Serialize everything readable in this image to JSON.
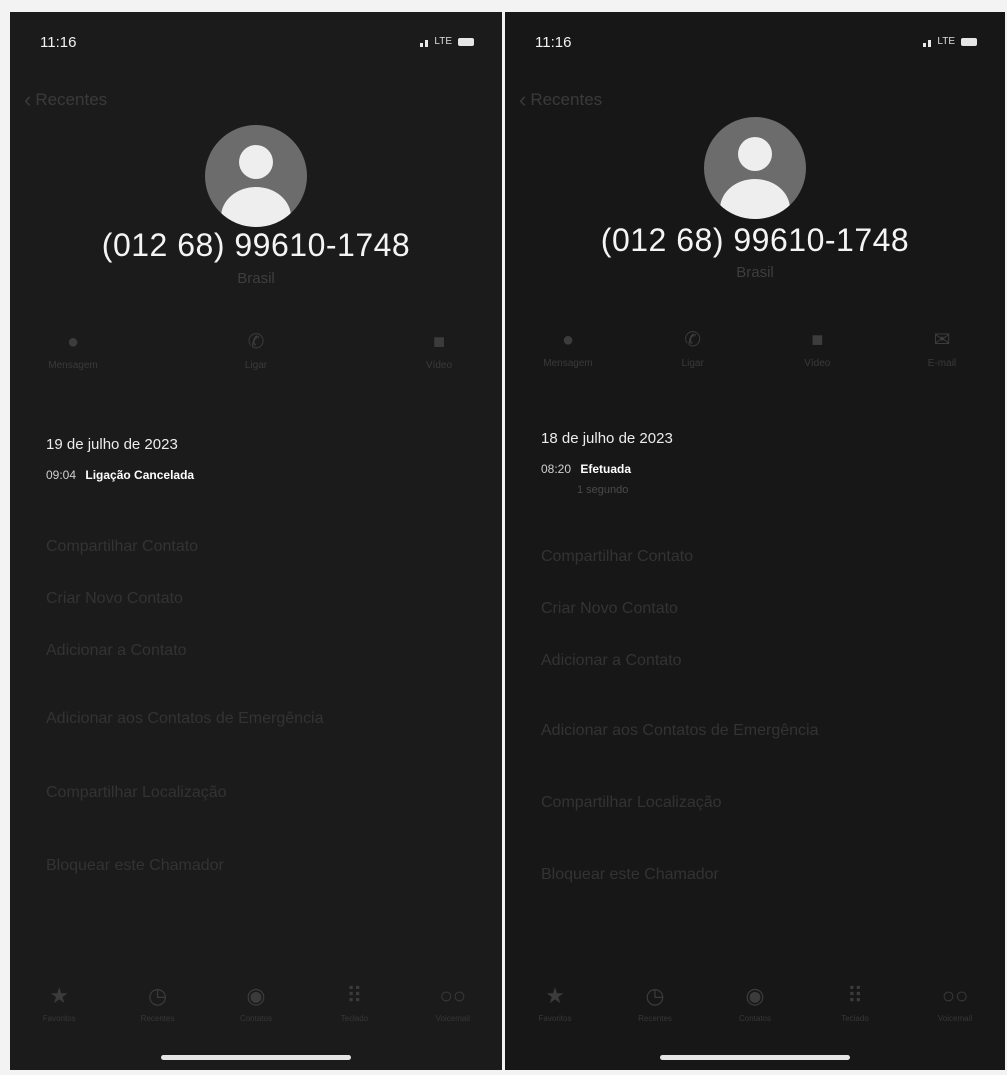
{
  "left": {
    "status": {
      "time": "11:16",
      "network": "LTE"
    },
    "back_label": "Recentes",
    "contact": {
      "number": "(012 68) 99610-1748",
      "country": "Brasil"
    },
    "actions": [
      {
        "label": "Mensagem",
        "icon": "message-icon"
      },
      {
        "label": "Ligar",
        "icon": "phone-icon"
      },
      {
        "label": "Vídeo",
        "icon": "video-icon"
      }
    ],
    "call_date": "19 de julho de 2023",
    "call_time": "09:04",
    "call_type": "Ligação Cancelada",
    "menu": [
      "Compartilhar Contato",
      "Criar Novo Contato",
      "Adicionar a Contato",
      "Adicionar aos Contatos de Emergência",
      "Compartilhar Localização",
      "Bloquear este Chamador"
    ],
    "tabs": [
      "Favoritos",
      "Recentes",
      "Contatos",
      "Teclado",
      "Voicemail"
    ]
  },
  "right": {
    "status": {
      "time": "11:16",
      "network": "LTE"
    },
    "back_label": "Recentes",
    "contact": {
      "number": "(012 68) 99610-1748",
      "country": "Brasil"
    },
    "actions": [
      {
        "label": "Mensagem",
        "icon": "message-icon"
      },
      {
        "label": "Ligar",
        "icon": "phone-icon"
      },
      {
        "label": "Vídeo",
        "icon": "video-icon"
      },
      {
        "label": "E-mail",
        "icon": "mail-icon"
      }
    ],
    "call_date": "18 de julho de 2023",
    "call_time": "08:20",
    "call_type": "Efetuada",
    "call_duration": "1 segundo",
    "menu": [
      "Compartilhar Contato",
      "Criar Novo Contato",
      "Adicionar a Contato",
      "Adicionar aos Contatos de Emergência",
      "Compartilhar Localização",
      "Bloquear este Chamador"
    ],
    "tabs": [
      "Favoritos",
      "Recentes",
      "Contatos",
      "Teclado",
      "Voicemail"
    ]
  }
}
